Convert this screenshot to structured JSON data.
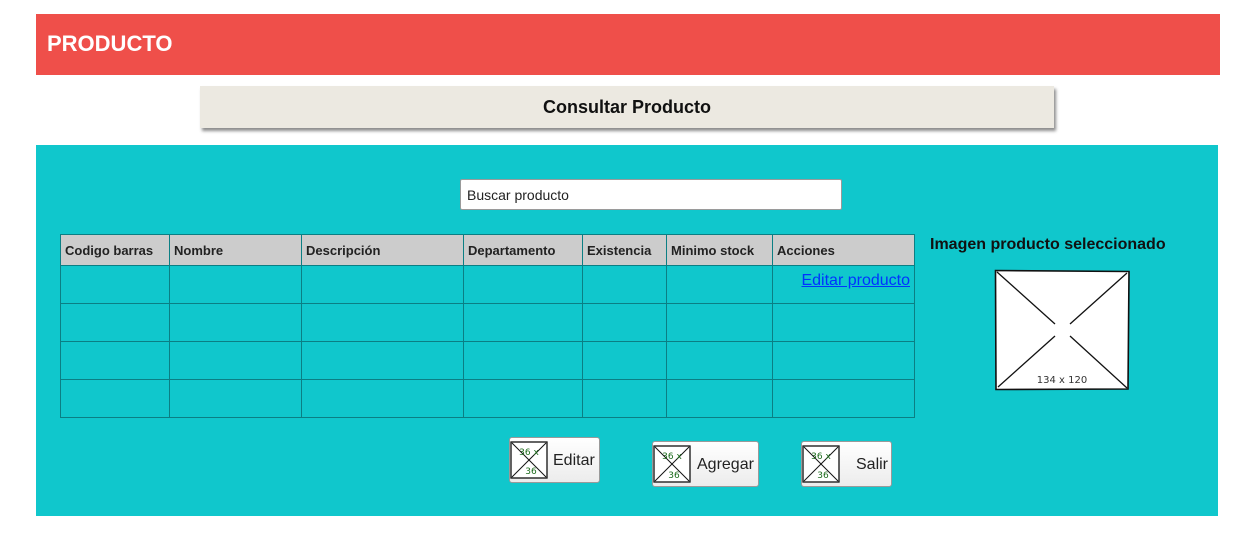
{
  "header": {
    "title": "PRODUCTO"
  },
  "subheader": {
    "title": "Consultar Producto"
  },
  "search": {
    "placeholder": "Buscar producto"
  },
  "table": {
    "columns": [
      "Codigo barras",
      "Nombre",
      "Descripción",
      "Departamento",
      "Existencia",
      "Minimo stock",
      "Acciones"
    ],
    "rows": [
      [
        "",
        "",
        "",
        "",
        "",
        "",
        "Editar producto"
      ],
      [
        "",
        "",
        "",
        "",
        "",
        "",
        ""
      ],
      [
        "",
        "",
        "",
        "",
        "",
        "",
        ""
      ],
      [
        "",
        "",
        "",
        "",
        "",
        "",
        ""
      ]
    ]
  },
  "image_panel": {
    "label": "Imagen producto seleccionado",
    "placeholder_text": "134 x 120"
  },
  "buttons": {
    "icon_text_top": "36 x",
    "icon_text_bottom": "36",
    "edit": "Editar",
    "add": "Agregar",
    "exit": "Salir"
  },
  "colors": {
    "header": "#ef4f4a",
    "subheader": "#ece9e1",
    "panel": "#10c7cc",
    "table_header": "#cccccc",
    "link": "#0033ff"
  }
}
